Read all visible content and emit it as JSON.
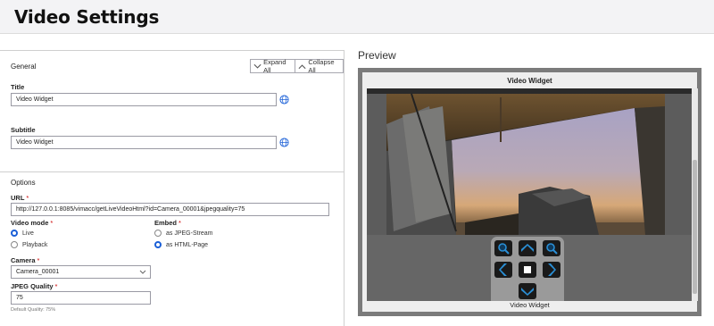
{
  "page": {
    "title": "Video Settings"
  },
  "general": {
    "section_label": "General",
    "expand_all": "Expand All",
    "collapse_all": "Collapse All",
    "title_label": "Title",
    "title_value": "Video Widget",
    "subtitle_label": "Subtitle",
    "subtitle_value": "Video Widget"
  },
  "options": {
    "section_label": "Options",
    "url_label": "URL",
    "url_value": "http://127.0.0.1:8085/vimacc/getLiveVideoHtml?id=Camera_00001&jpegquality=75",
    "video_mode_label": "Video mode",
    "video_mode_options": [
      "Live",
      "Playback"
    ],
    "video_mode_selected": "Live",
    "embed_label": "Embed",
    "embed_options": [
      "as JPEG-Stream",
      "as HTML-Page"
    ],
    "embed_selected": "as HTML-Page",
    "camera_label": "Camera",
    "camera_value": "Camera_00001",
    "jpeg_quality_label": "JPEG Quality",
    "jpeg_quality_value": "75",
    "jpeg_quality_hint": "Default Quality: 75%",
    "required_marker": "*"
  },
  "preview": {
    "label": "Preview",
    "widget_title": "Video Widget",
    "widget_subtitle": "Video Widget"
  },
  "colors": {
    "accent": "#1a5fd7",
    "ptz_button": "#1a1a1a",
    "ptz_glyph": "#2a8fd6",
    "frame": "#7b7b7b"
  },
  "icons": [
    "chevron-down-icon",
    "chevron-up-icon",
    "globe-icon",
    "zoom-in-icon",
    "zoom-out-icon",
    "arrow-up-icon",
    "arrow-down-icon",
    "arrow-left-icon",
    "arrow-right-icon",
    "stop-icon"
  ]
}
